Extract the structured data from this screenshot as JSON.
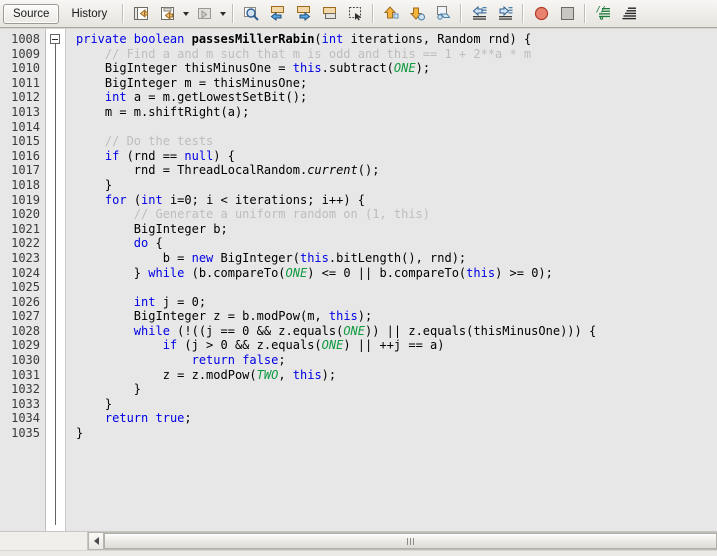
{
  "window": {
    "title": "Source Editor",
    "background": "#e7e7e7"
  },
  "toolbar": {
    "tabs": [
      {
        "label": "Source",
        "name": "tab-source",
        "active": true
      },
      {
        "label": "History",
        "name": "tab-history",
        "active": false
      }
    ],
    "buttons": [
      {
        "name": "last-edit-icon",
        "tooltip": "Last Edit",
        "has_caret": false
      },
      {
        "name": "back-edit-icon",
        "tooltip": "Back",
        "has_caret": true
      },
      {
        "name": "forward-edit-icon",
        "tooltip": "Forward",
        "has_caret": true
      },
      {
        "name": "find-selection-icon",
        "tooltip": "Find Selection",
        "has_caret": false
      },
      {
        "name": "previous-bookmark-icon",
        "tooltip": "Previous Bookmark",
        "has_caret": false
      },
      {
        "name": "next-bookmark-icon",
        "tooltip": "Next Bookmark",
        "has_caret": false
      },
      {
        "name": "toggle-bookmark-icon",
        "tooltip": "Toggle Bookmark",
        "has_caret": false
      },
      {
        "name": "toggle-rectangular-selection-icon",
        "tooltip": "Toggle Rectangular Selection",
        "has_caret": false
      },
      {
        "name": "previous-error-icon",
        "tooltip": "Previous Error",
        "has_caret": false
      },
      {
        "name": "next-error-icon",
        "tooltip": "Next Error",
        "has_caret": false
      },
      {
        "name": "inspect-icon",
        "tooltip": "Inspect",
        "has_caret": false
      },
      {
        "name": "shift-line-left-icon",
        "tooltip": "Shift Line Left",
        "has_caret": false
      },
      {
        "name": "shift-line-right-icon",
        "tooltip": "Shift Line Right",
        "has_caret": false
      },
      {
        "name": "toggle-breakpoint-icon",
        "tooltip": "Toggle Breakpoint",
        "has_caret": false
      },
      {
        "name": "stop-icon",
        "tooltip": "Stop",
        "has_caret": false
      },
      {
        "name": "comment-icon",
        "tooltip": "Comment",
        "has_caret": false
      },
      {
        "name": "uncomment-icon",
        "tooltip": "Uncomment",
        "has_caret": false
      }
    ]
  },
  "editor": {
    "first_line": 1008,
    "last_line": 1035,
    "line_numbers": [
      "1008",
      "1009",
      "1010",
      "1011",
      "1012",
      "1013",
      "1014",
      "1015",
      "1016",
      "1017",
      "1018",
      "1019",
      "1020",
      "1021",
      "1022",
      "1023",
      "1024",
      "1025",
      "1026",
      "1027",
      "1028",
      "1029",
      "1030",
      "1031",
      "1032",
      "1033",
      "1034",
      "1035"
    ],
    "fold_marker": {
      "state": "expanded",
      "line": 1008
    },
    "colors": {
      "background": "#e7e7e7",
      "gutter_background": "#e7e7e7",
      "keyword": "#0000e6",
      "comment": "#bdbdbd",
      "field": "#0f9a3e",
      "text": "#000000"
    },
    "lines": [
      {
        "n": "1008",
        "tokens": [
          {
            "t": "private ",
            "c": "kw"
          },
          {
            "t": "boolean ",
            "c": "kw"
          },
          {
            "t": "passesMillerRabin",
            "c": "mthb"
          },
          {
            "t": "(",
            "c": "pln"
          },
          {
            "t": "int",
            "c": "kw"
          },
          {
            "t": " iterations, Random rnd) {",
            "c": "pln"
          }
        ]
      },
      {
        "n": "1009",
        "tokens": [
          {
            "t": "    // Find a and m such that m is odd and this == 1 + 2**a * m",
            "c": "cmt"
          }
        ]
      },
      {
        "n": "1010",
        "tokens": [
          {
            "t": "    BigInteger thisMinusOne = ",
            "c": "pln"
          },
          {
            "t": "this",
            "c": "kw"
          },
          {
            "t": ".subtract(",
            "c": "pln"
          },
          {
            "t": "ONE",
            "c": "fld"
          },
          {
            "t": ");",
            "c": "pln"
          }
        ]
      },
      {
        "n": "1011",
        "tokens": [
          {
            "t": "    BigInteger m = thisMinusOne;",
            "c": "pln"
          }
        ]
      },
      {
        "n": "1012",
        "tokens": [
          {
            "t": "    ",
            "c": "pln"
          },
          {
            "t": "int",
            "c": "kw"
          },
          {
            "t": " a = m.getLowestSetBit();",
            "c": "pln"
          }
        ]
      },
      {
        "n": "1013",
        "tokens": [
          {
            "t": "    m = m.shiftRight(a);",
            "c": "pln"
          }
        ]
      },
      {
        "n": "1014",
        "tokens": [
          {
            "t": "",
            "c": "pln"
          }
        ]
      },
      {
        "n": "1015",
        "tokens": [
          {
            "t": "    // Do the tests",
            "c": "cmt"
          }
        ]
      },
      {
        "n": "1016",
        "tokens": [
          {
            "t": "    ",
            "c": "pln"
          },
          {
            "t": "if",
            "c": "kw"
          },
          {
            "t": " (rnd == ",
            "c": "pln"
          },
          {
            "t": "null",
            "c": "kw"
          },
          {
            "t": ") {",
            "c": "pln"
          }
        ]
      },
      {
        "n": "1017",
        "tokens": [
          {
            "t": "        rnd = ThreadLocalRandom.",
            "c": "pln"
          },
          {
            "t": "current",
            "c": "mth"
          },
          {
            "t": "();",
            "c": "pln"
          }
        ]
      },
      {
        "n": "1018",
        "tokens": [
          {
            "t": "    }",
            "c": "pln"
          }
        ]
      },
      {
        "n": "1019",
        "tokens": [
          {
            "t": "    ",
            "c": "pln"
          },
          {
            "t": "for",
            "c": "kw"
          },
          {
            "t": " (",
            "c": "pln"
          },
          {
            "t": "int",
            "c": "kw"
          },
          {
            "t": " i=0; i < iterations; i++) {",
            "c": "pln"
          }
        ]
      },
      {
        "n": "1020",
        "tokens": [
          {
            "t": "        // Generate a uniform random on (1, this)",
            "c": "cmt"
          }
        ]
      },
      {
        "n": "1021",
        "tokens": [
          {
            "t": "        BigInteger b;",
            "c": "pln"
          }
        ]
      },
      {
        "n": "1022",
        "tokens": [
          {
            "t": "        ",
            "c": "pln"
          },
          {
            "t": "do",
            "c": "kw"
          },
          {
            "t": " {",
            "c": "pln"
          }
        ]
      },
      {
        "n": "1023",
        "tokens": [
          {
            "t": "            b = ",
            "c": "pln"
          },
          {
            "t": "new",
            "c": "kw"
          },
          {
            "t": " BigInteger(",
            "c": "pln"
          },
          {
            "t": "this",
            "c": "kw"
          },
          {
            "t": ".bitLength(), rnd);",
            "c": "pln"
          }
        ]
      },
      {
        "n": "1024",
        "tokens": [
          {
            "t": "        } ",
            "c": "pln"
          },
          {
            "t": "while",
            "c": "kw"
          },
          {
            "t": " (b.compareTo(",
            "c": "pln"
          },
          {
            "t": "ONE",
            "c": "fld"
          },
          {
            "t": ") <= 0 || b.compareTo(",
            "c": "pln"
          },
          {
            "t": "this",
            "c": "kw"
          },
          {
            "t": ") >= 0);",
            "c": "pln"
          }
        ]
      },
      {
        "n": "1025",
        "tokens": [
          {
            "t": "",
            "c": "pln"
          }
        ]
      },
      {
        "n": "1026",
        "tokens": [
          {
            "t": "        ",
            "c": "pln"
          },
          {
            "t": "int",
            "c": "kw"
          },
          {
            "t": " j = 0;",
            "c": "pln"
          }
        ]
      },
      {
        "n": "1027",
        "tokens": [
          {
            "t": "        BigInteger z = b.modPow(m, ",
            "c": "pln"
          },
          {
            "t": "this",
            "c": "kw"
          },
          {
            "t": ");",
            "c": "pln"
          }
        ]
      },
      {
        "n": "1028",
        "tokens": [
          {
            "t": "        ",
            "c": "pln"
          },
          {
            "t": "while",
            "c": "kw"
          },
          {
            "t": " (!((j == 0 && z.equals(",
            "c": "pln"
          },
          {
            "t": "ONE",
            "c": "fld"
          },
          {
            "t": ")) || z.equals(thisMinusOne))) {",
            "c": "pln"
          }
        ]
      },
      {
        "n": "1029",
        "tokens": [
          {
            "t": "            ",
            "c": "pln"
          },
          {
            "t": "if",
            "c": "kw"
          },
          {
            "t": " (j > 0 && z.equals(",
            "c": "pln"
          },
          {
            "t": "ONE",
            "c": "fld"
          },
          {
            "t": ") || ++j == a)",
            "c": "pln"
          }
        ]
      },
      {
        "n": "1030",
        "tokens": [
          {
            "t": "                ",
            "c": "pln"
          },
          {
            "t": "return",
            "c": "kw"
          },
          {
            "t": " ",
            "c": "pln"
          },
          {
            "t": "false",
            "c": "kw"
          },
          {
            "t": ";",
            "c": "pln"
          }
        ]
      },
      {
        "n": "1031",
        "tokens": [
          {
            "t": "            z = z.modPow(",
            "c": "pln"
          },
          {
            "t": "TWO",
            "c": "fld"
          },
          {
            "t": ", ",
            "c": "pln"
          },
          {
            "t": "this",
            "c": "kw"
          },
          {
            "t": ");",
            "c": "pln"
          }
        ]
      },
      {
        "n": "1032",
        "tokens": [
          {
            "t": "        }",
            "c": "pln"
          }
        ]
      },
      {
        "n": "1033",
        "tokens": [
          {
            "t": "    }",
            "c": "pln"
          }
        ]
      },
      {
        "n": "1034",
        "tokens": [
          {
            "t": "    ",
            "c": "pln"
          },
          {
            "t": "return",
            "c": "kw"
          },
          {
            "t": " ",
            "c": "pln"
          },
          {
            "t": "true",
            "c": "kw"
          },
          {
            "t": ";",
            "c": "pln"
          }
        ]
      },
      {
        "n": "1035",
        "tokens": [
          {
            "t": "}",
            "c": "pln"
          }
        ]
      }
    ]
  },
  "scrollbar": {
    "orientation": "horizontal",
    "left_arrow": "left-arrow-icon",
    "thumb_grip": "scrollbar-grip",
    "position_percent": 0
  }
}
